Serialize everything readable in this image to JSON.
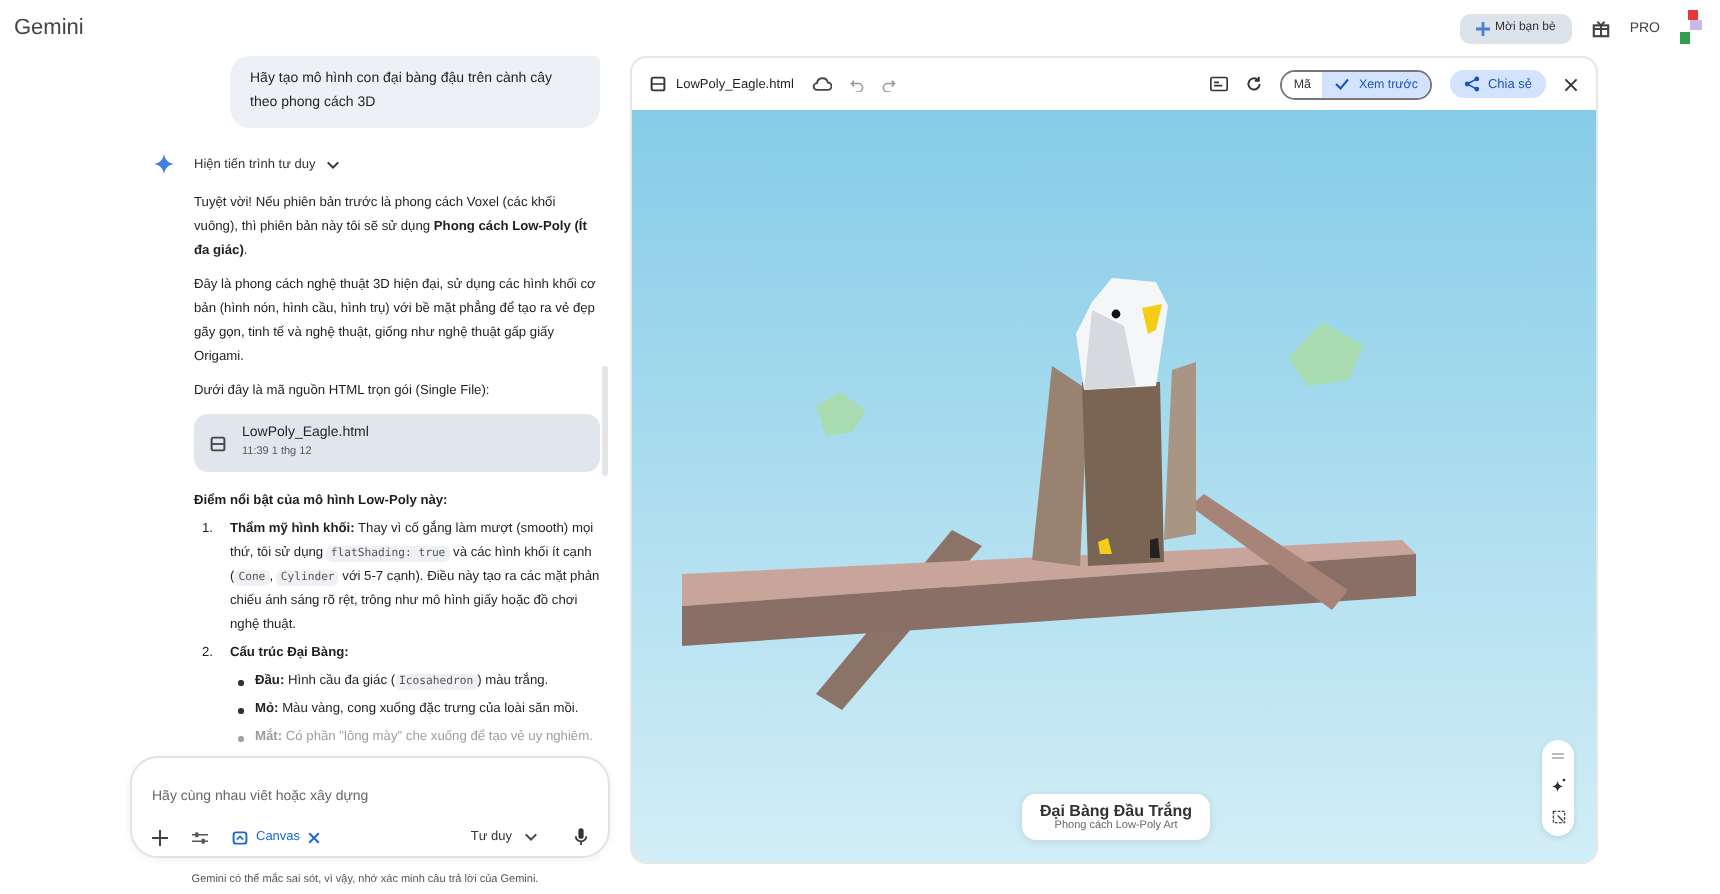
{
  "app_title": "Gemini",
  "header": {
    "invite_button": "Mời bạn bè",
    "plan_badge": "PRO"
  },
  "chat": {
    "user_message": "Hãy tạo mô hình con đại bàng đậu trên cành cây theo phong cách 3D",
    "thinking_toggle": "Hiện tiến trình tư duy",
    "paragraphs": [
      "Tuyệt vời! Nếu phiên bản trước là phong cách Voxel (các khối vuông), thì phiên bản này tôi sẽ sử dụng **Phong cách Low-Poly (Ít đa giác)**.",
      "Đây là phong cách nghệ thuật 3D hiện đại, sử dụng các hình khối cơ bản (hình nón, hình cầu, hình trụ) với bề mặt phẳng để tạo ra vẻ đẹp gãy gọn, tinh tế và nghệ thuật, giống như nghệ thuật gấp giấy Origami.",
      "Dưới đây là mã nguồn HTML trọn gói (Single File):"
    ],
    "file_card": {
      "name": "LowPoly_Eagle.html",
      "time": "11:39 1 thg 12"
    },
    "highlights_heading": "Điểm nổi bật của mô hình Low-Poly này:",
    "highlights": [
      {
        "number": "1.",
        "label": "Thẩm mỹ hình khối:",
        "segments": [
          {
            "kind": "text",
            "text": "Thay vì cố gắng làm mượt (smooth) mọi thứ, tôi sử dụng "
          },
          {
            "kind": "code",
            "text": "flatShading: true"
          },
          {
            "kind": "text",
            "text": " và các hình khối ít cạnh ("
          },
          {
            "kind": "code",
            "text": "Cone"
          },
          {
            "kind": "text",
            "text": ", "
          },
          {
            "kind": "code",
            "text": "Cylinder"
          },
          {
            "kind": "text",
            "text": " với 5-7 cạnh). Điều này tạo ra các mặt phản chiếu ánh sáng rõ rệt, trông như mô hình giấy hoặc đồ chơi nghệ thuật."
          }
        ]
      },
      {
        "number": "2.",
        "label": "Cấu trúc Đại Bàng:",
        "children": [
          {
            "label": "Đầu:",
            "segments": [
              {
                "kind": "text",
                "text": "Hình cầu đa giác ("
              },
              {
                "kind": "code",
                "text": "Icosahedron"
              },
              {
                "kind": "text",
                "text": ") màu trắng."
              }
            ]
          },
          {
            "label": "Mỏ:",
            "segments": [
              {
                "kind": "text",
                "text": "Màu vàng, cong xuống đặc trưng của loài săn mồi."
              }
            ]
          },
          {
            "label": "Mắt:",
            "segments": [
              {
                "kind": "text",
                "text": "Có phần \"lông mày\" che xuống để tạo vẻ uy nghiêm."
              }
            ]
          }
        ]
      }
    ]
  },
  "composer": {
    "placeholder": "Hãy cùng nhau viết hoặc xây dựng",
    "canvas_chip": "Canvas",
    "mode": "Tư duy"
  },
  "disclaimer": "Gemini có thể mắc sai sót, vì vậy, nhớ xác minh câu trả lời của Gemini.",
  "canvas": {
    "file_name": "LowPoly_Eagle.html",
    "view_toggle": [
      {
        "label": "Mã",
        "selected": false
      },
      {
        "label": "Xem trước",
        "selected": true
      }
    ],
    "share_button": "Chia sẻ",
    "preview": {
      "caption_title": "Đại Bàng Đầu Trắng",
      "caption_subtitle": "Phong cách Low-Poly Art"
    }
  }
}
